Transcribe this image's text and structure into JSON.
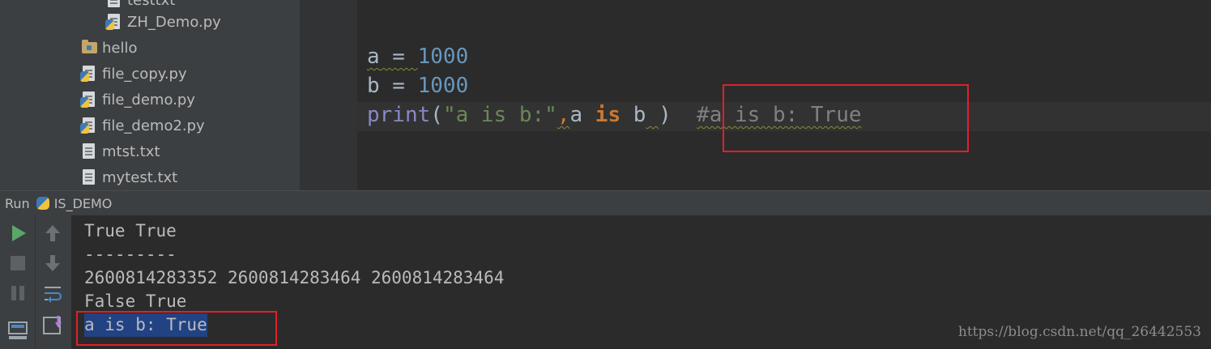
{
  "project_tree": {
    "items": [
      {
        "name": "testtxt",
        "type": "text"
      },
      {
        "name": "ZH_Demo.py",
        "type": "python"
      },
      {
        "name": "hello",
        "type": "folder"
      },
      {
        "name": "file_copy.py",
        "type": "python"
      },
      {
        "name": "file_demo.py",
        "type": "python"
      },
      {
        "name": "file_demo2.py",
        "type": "python"
      },
      {
        "name": "mtst.txt",
        "type": "text"
      },
      {
        "name": "mytest.txt",
        "type": "text"
      }
    ]
  },
  "editor": {
    "line1": {
      "var": "a",
      "op": " = ",
      "value": "1000"
    },
    "line2": {
      "var": "b",
      "op": " = ",
      "value": "1000"
    },
    "line3": {
      "func": "print",
      "open": "(",
      "string": "\"a is b:\"",
      "comma": ",",
      "arg_a": "a",
      "sp1": " ",
      "kw_is": "is",
      "sp2": " ",
      "arg_b": "b",
      "sp3": " ",
      "close": ")",
      "gap": "  ",
      "comment": "#a is b: True"
    }
  },
  "run_panel": {
    "label": "Run",
    "config_name": "IS_DEMO",
    "console_lines": [
      "True True",
      "---------",
      "2600814283352 2600814283464 2600814283464",
      "False True",
      "a is b: True"
    ]
  },
  "icons": {
    "run": "play-icon",
    "stop": "stop-icon",
    "pause": "pause-icon",
    "up": "arrow-up-icon",
    "down": "arrow-down-icon",
    "wrap": "soft-wrap-icon",
    "layout": "restore-layout-icon",
    "scroll": "scroll-to-end-icon"
  },
  "colors": {
    "highlight_box": "#e0202a",
    "selection": "#214283",
    "run_green": "#59a869"
  },
  "watermark": "https://blog.csdn.net/qq_26442553"
}
